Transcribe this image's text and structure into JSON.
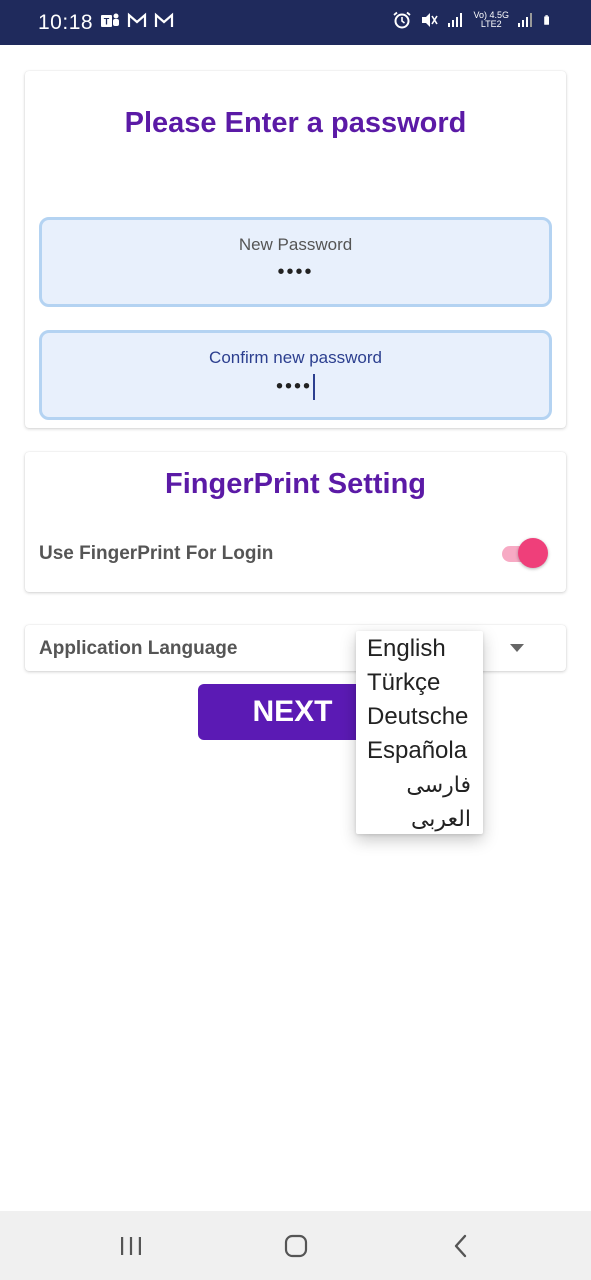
{
  "status_bar": {
    "time": "10:18",
    "network_line1": "Vo) 4.5G",
    "network_line2": "LTE2",
    "left_icons": [
      "teams-icon",
      "gmail-icon",
      "gmail-icon"
    ],
    "right_icons": [
      "alarm-icon",
      "mute-icon",
      "signal-icon",
      "signal-icon",
      "battery-icon"
    ]
  },
  "password_card": {
    "title": "Please Enter a password",
    "new_password_label": "New Password",
    "new_password_value": "••••",
    "confirm_password_label": "Confirm new password",
    "confirm_password_value": "••••"
  },
  "fingerprint_card": {
    "title": "FingerPrint Setting",
    "toggle_label": "Use FingerPrint For Login",
    "toggle_on": true
  },
  "language": {
    "label": "Application Language",
    "options": [
      "English",
      "Türkçe",
      "Deutsche",
      "Española",
      "فارسی",
      "العربی"
    ]
  },
  "next_button": {
    "label": "NEXT"
  },
  "colors": {
    "accent": "#5b1aa6",
    "toggle": "#ef3f7a",
    "field_bg": "#e8f0fc",
    "status_bar": "#1f2a5c"
  }
}
